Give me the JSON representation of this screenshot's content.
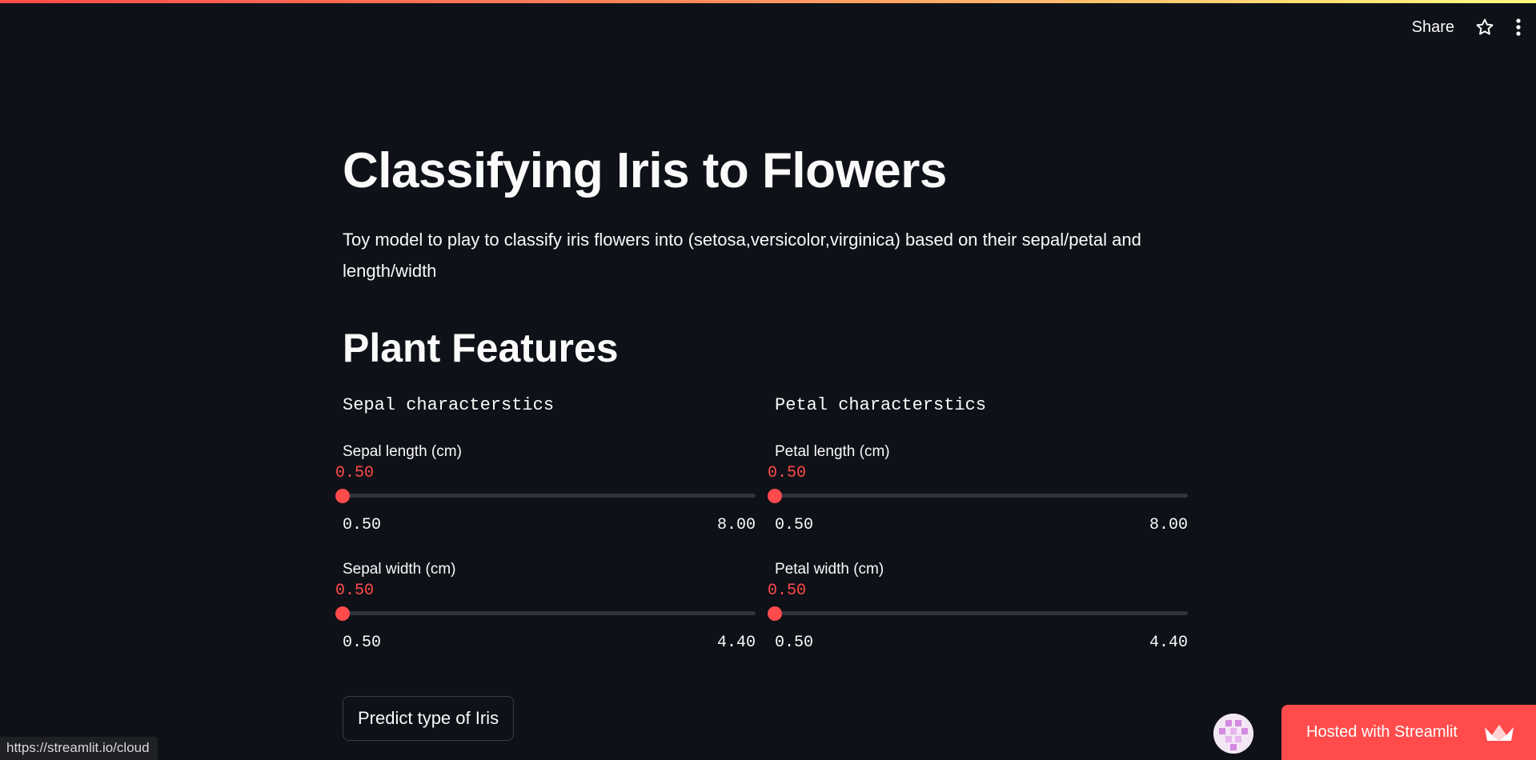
{
  "toolbar": {
    "share_label": "Share",
    "star_icon": "star-icon",
    "menu_icon": "kebab-menu-icon"
  },
  "main": {
    "title": "Classifying Iris to Flowers",
    "description": "Toy model to play to classify iris flowers into (setosa,versicolor,virginica) based on their sepal/petal and length/width",
    "section_title": "Plant Features",
    "columns": [
      {
        "header": "Sepal characterstics",
        "sliders": [
          {
            "label": "Sepal length (cm)",
            "value": "0.50",
            "min": "0.50",
            "max": "8.00",
            "fraction": 0.0
          },
          {
            "label": "Sepal width (cm)",
            "value": "0.50",
            "min": "0.50",
            "max": "4.40",
            "fraction": 0.0
          }
        ]
      },
      {
        "header": "Petal characterstics",
        "sliders": [
          {
            "label": "Petal length (cm)",
            "value": "0.50",
            "min": "0.50",
            "max": "8.00",
            "fraction": 0.0
          },
          {
            "label": "Petal width (cm)",
            "value": "0.50",
            "min": "0.50",
            "max": "4.40",
            "fraction": 0.0
          }
        ]
      }
    ],
    "predict_button": "Predict type of Iris"
  },
  "status_bar": {
    "url": "https://streamlit.io/cloud"
  },
  "footer": {
    "hosted_label": "Hosted with Streamlit",
    "hosted_icon": "streamlit-crown-icon"
  },
  "colors": {
    "background": "#0e1117",
    "accent": "#ff4b4b",
    "text": "#fafafa"
  }
}
